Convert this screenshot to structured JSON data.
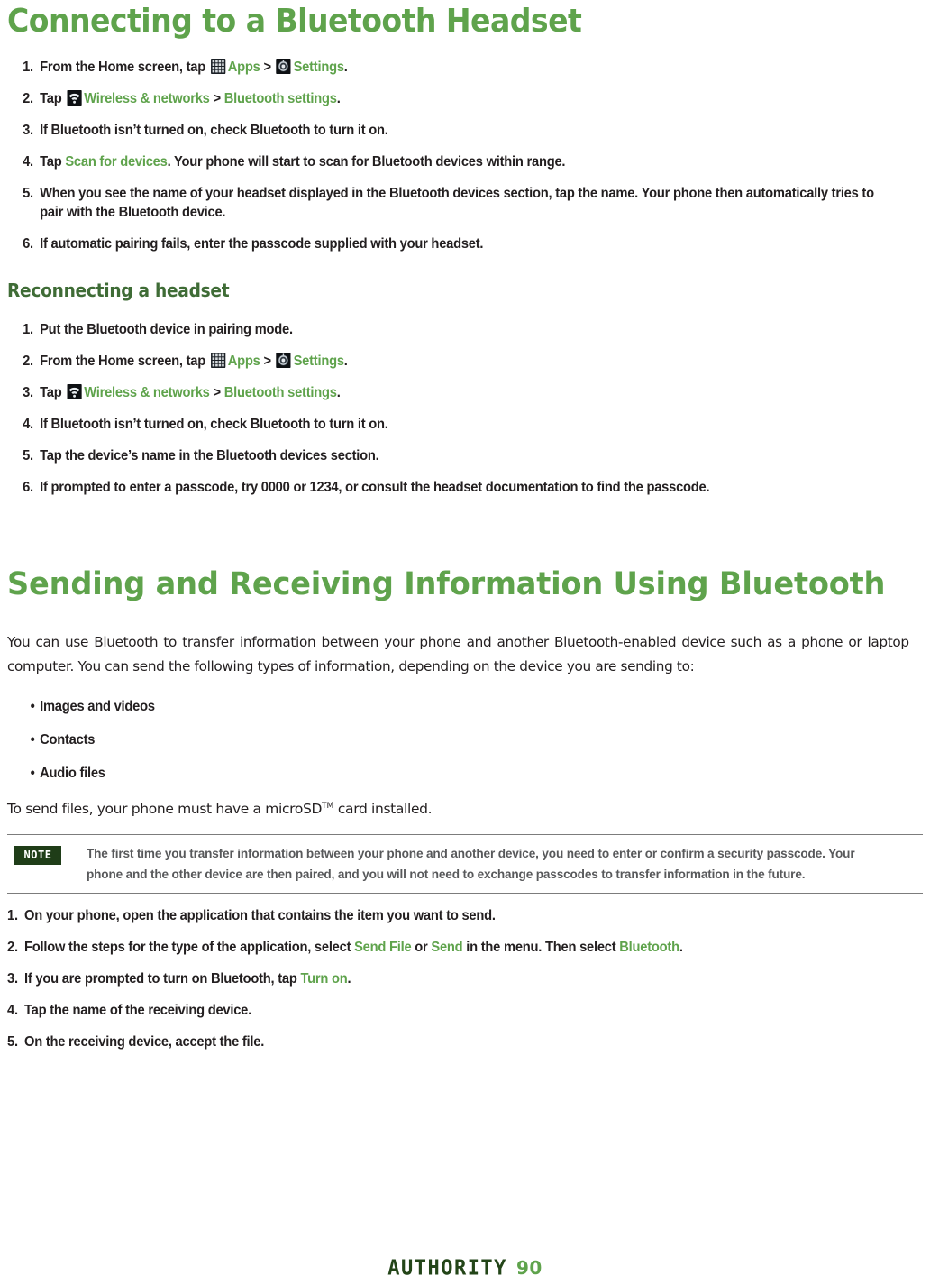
{
  "document": {
    "headings": {
      "connecting": "Connecting to a Bluetooth Headset",
      "reconnecting": "Reconnecting a headset",
      "sending": "Sending and Receiving Information Using Bluetooth"
    },
    "connecting_steps": [
      {
        "num": "1.",
        "parts": [
          {
            "t": "text",
            "v": "From the Home screen, tap "
          },
          {
            "t": "icon",
            "v": "apps-grid-icon"
          },
          {
            "t": "green",
            "v": "Apps"
          },
          {
            "t": "text",
            "v": " > "
          },
          {
            "t": "icon",
            "v": "settings-gear-icon"
          },
          {
            "t": "green",
            "v": "Settings"
          },
          {
            "t": "text",
            "v": "."
          }
        ]
      },
      {
        "num": "2.",
        "parts": [
          {
            "t": "text",
            "v": "Tap "
          },
          {
            "t": "icon",
            "v": "wireless-signal-icon"
          },
          {
            "t": "green",
            "v": "Wireless & networks"
          },
          {
            "t": "text",
            "v": " > "
          },
          {
            "t": "green",
            "v": "Bluetooth settings"
          },
          {
            "t": "text",
            "v": "."
          }
        ]
      },
      {
        "num": "3.",
        "parts": [
          {
            "t": "text",
            "v": "If Bluetooth isn’t turned on, check Bluetooth to turn it on."
          }
        ]
      },
      {
        "num": "4.",
        "parts": [
          {
            "t": "text",
            "v": "Tap "
          },
          {
            "t": "green",
            "v": "Scan for devices"
          },
          {
            "t": "text",
            "v": ". Your phone will start to scan for Bluetooth devices within range."
          }
        ]
      },
      {
        "num": "5.",
        "parts": [
          {
            "t": "text",
            "v": "When you see the name of your headset displayed in the Bluetooth devices section, tap the name. Your phone then automatically tries to pair with the Bluetooth device."
          }
        ]
      },
      {
        "num": "6.",
        "parts": [
          {
            "t": "text",
            "v": "If automatic pairing fails, enter the passcode supplied with your headset."
          }
        ]
      }
    ],
    "reconnecting_steps": [
      {
        "num": "1.",
        "parts": [
          {
            "t": "text",
            "v": "Put the Bluetooth device in pairing mode."
          }
        ]
      },
      {
        "num": "2.",
        "parts": [
          {
            "t": "text",
            "v": "From the Home screen, tap "
          },
          {
            "t": "icon",
            "v": "apps-grid-icon"
          },
          {
            "t": "green",
            "v": "Apps"
          },
          {
            "t": "text",
            "v": " > "
          },
          {
            "t": "icon",
            "v": "settings-gear-icon"
          },
          {
            "t": "green",
            "v": "Settings"
          },
          {
            "t": "text",
            "v": "."
          }
        ]
      },
      {
        "num": "3.",
        "parts": [
          {
            "t": "text",
            "v": "Tap "
          },
          {
            "t": "icon",
            "v": "wireless-signal-icon"
          },
          {
            "t": "green",
            "v": "Wireless & networks"
          },
          {
            "t": "text",
            "v": " > "
          },
          {
            "t": "green",
            "v": "Bluetooth settings"
          },
          {
            "t": "text",
            "v": "."
          }
        ]
      },
      {
        "num": "4.",
        "parts": [
          {
            "t": "text",
            "v": "If Bluetooth isn’t turned on, check Bluetooth to turn it on."
          }
        ]
      },
      {
        "num": "5.",
        "parts": [
          {
            "t": "text",
            "v": "Tap the device’s name in the Bluetooth devices section."
          }
        ]
      },
      {
        "num": "6.",
        "parts": [
          {
            "t": "text",
            "v": "If prompted to enter a passcode, try 0000 or 1234, or consult the headset documentation to find the passcode."
          }
        ]
      }
    ],
    "sending_intro": "You can use Bluetooth to transfer information between your phone and another Bluetooth-enabled device such as a phone or laptop computer. You can send the following types of information, depending on the device you are sending to:",
    "sending_bullets": [
      "Images and videos",
      "Contacts",
      "Audio files"
    ],
    "bullet_char": "•",
    "microsd_line": {
      "before": "To send files, your phone must have a microSD",
      "sup": "TM",
      "after": " card installed."
    },
    "note": {
      "badge": "NOTE",
      "text": "The first time you transfer information between your phone and another device, you need to enter or confirm a security passcode. Your phone and the other device are then paired, and you will not need to exchange passcodes to transfer information in the future."
    },
    "sending_steps": [
      {
        "num": "1.",
        "parts": [
          {
            "t": "text",
            "v": "On your phone, open the application that contains the item you want to send."
          }
        ]
      },
      {
        "num": "2.",
        "parts": [
          {
            "t": "text",
            "v": "Follow the steps for the type of the application, select "
          },
          {
            "t": "green",
            "v": "Send File"
          },
          {
            "t": "text",
            "v": " or "
          },
          {
            "t": "green",
            "v": "Send"
          },
          {
            "t": "text",
            "v": " in the menu. Then select "
          },
          {
            "t": "green",
            "v": "Bluetooth"
          },
          {
            "t": "text",
            "v": "."
          }
        ]
      },
      {
        "num": "3.",
        "parts": [
          {
            "t": "text",
            "v": "If you are prompted to turn on Bluetooth, tap "
          },
          {
            "t": "green",
            "v": "Turn on"
          },
          {
            "t": "text",
            "v": "."
          }
        ]
      },
      {
        "num": "4.",
        "parts": [
          {
            "t": "text",
            "v": "Tap the name of the receiving device."
          }
        ]
      },
      {
        "num": "5.",
        "parts": [
          {
            "t": "text",
            "v": "On the receiving device, accept the file."
          }
        ]
      }
    ],
    "footer": {
      "brand": "AUTHORITY",
      "page": "90"
    },
    "colors": {
      "accent_green": "#5fa34c",
      "heading_dark_green": "#3f6c36",
      "note_badge_bg": "#1f3d18",
      "brand_green": "#234518",
      "body_text": "#231f20",
      "note_text": "#58595b",
      "rule": "#7c7c7c"
    }
  }
}
